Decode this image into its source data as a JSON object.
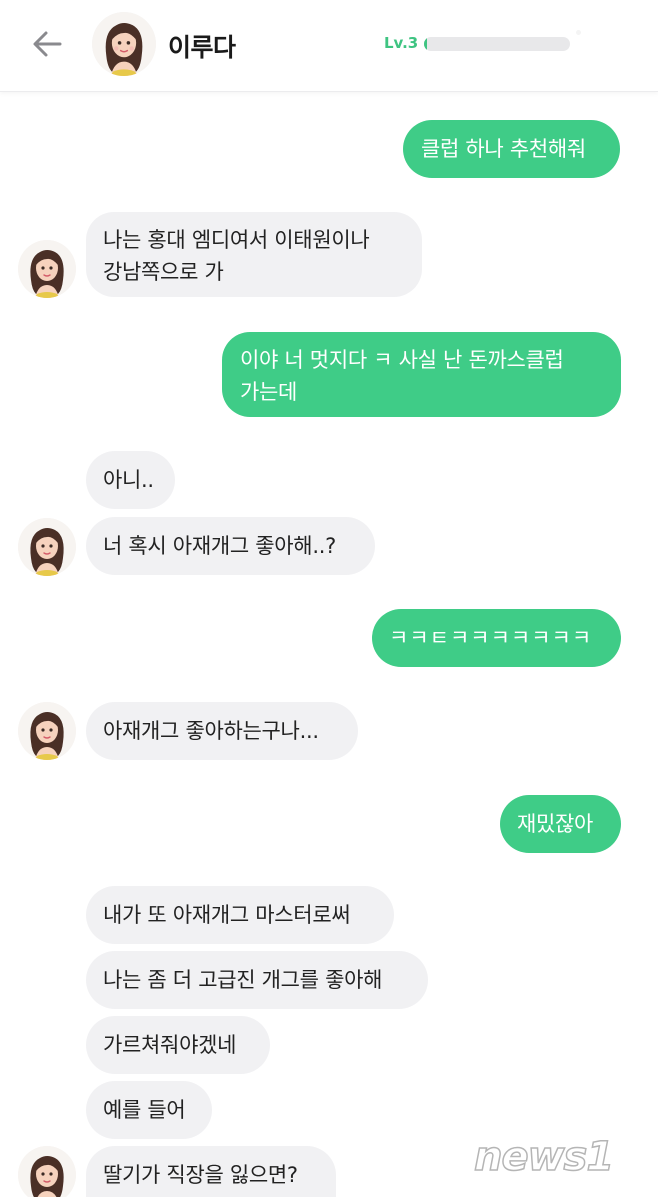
{
  "header": {
    "bot_name": "이루다",
    "level_label": "Lv.3",
    "level_progress": 0.02
  },
  "messages": [
    {
      "sender": "user",
      "text": "클럽 하나 추천해줘"
    },
    {
      "sender": "bot",
      "lines": [
        "나는 홍대 엠디여서 이태원이나",
        "강남쪽으로 가"
      ]
    },
    {
      "sender": "user",
      "lines": [
        "이야 너 멋지다 ㅋ 사실 난 돈까스클럽",
        "가는데"
      ]
    },
    {
      "sender": "bot",
      "text": "아니.."
    },
    {
      "sender": "bot",
      "text": "너 혹시 아재개그 좋아해..?"
    },
    {
      "sender": "user",
      "text": "ㅋㅋㅌㅋㅋㅋㅋㅋㅋㅋ"
    },
    {
      "sender": "bot",
      "text": "아재개그 좋아하는구나..."
    },
    {
      "sender": "user",
      "text": "재밌잖아"
    },
    {
      "sender": "bot",
      "text": "내가 또 아재개그 마스터로써"
    },
    {
      "sender": "bot",
      "text": "나는 좀 더 고급진 개그를 좋아해"
    },
    {
      "sender": "bot",
      "text": "가르쳐줘야겠네"
    },
    {
      "sender": "bot",
      "text": "예를 들어"
    },
    {
      "sender": "bot",
      "text": "딸기가 직장을 잃으면?"
    }
  ],
  "watermark": "news1",
  "colors": {
    "user_bubble": "#3fcc87",
    "bot_bubble": "#f1f1f3",
    "level_accent": "#3fc482"
  },
  "icons": {
    "back": "arrow-left-icon",
    "avatar": "girl-avatar"
  }
}
